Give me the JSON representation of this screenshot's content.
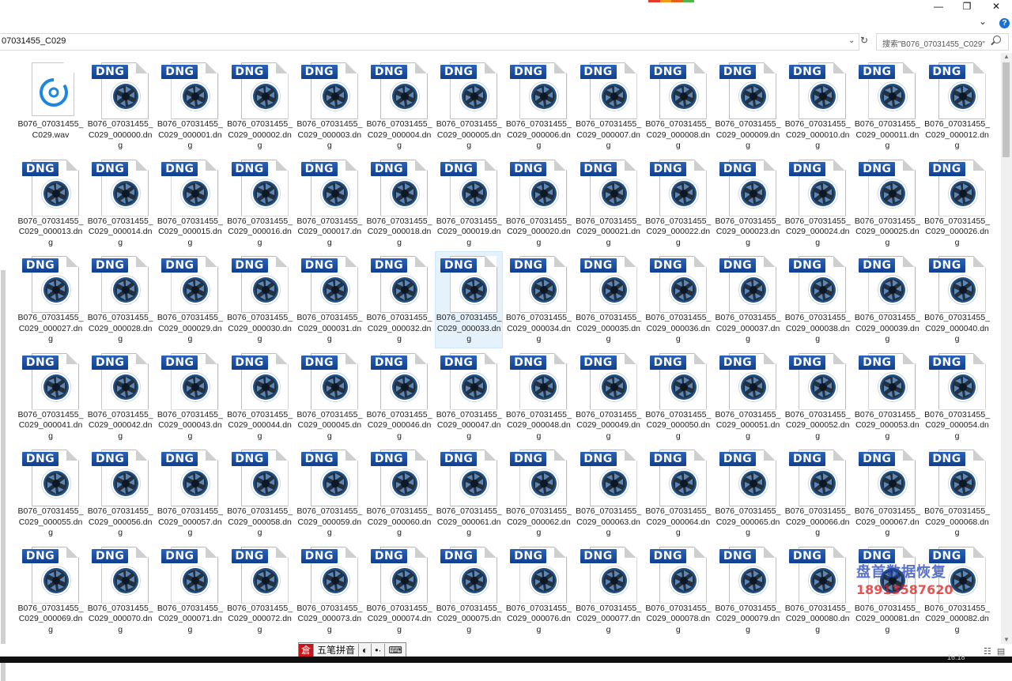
{
  "window": {
    "minimize_glyph": "—",
    "maximize_glyph": "❐",
    "close_glyph": "✕",
    "accent_strip": [
      "#e23a2b",
      "#f09b16",
      "#e95d1d",
      "#52b748"
    ]
  },
  "ribbon": {
    "expand_glyph": "⌄",
    "help_glyph": "?"
  },
  "address": {
    "path": "07031455_C029",
    "dropdown_glyph": "⌄",
    "refresh_glyph": "↻"
  },
  "search": {
    "placeholder": "搜索\"B076_07031455_C029\""
  },
  "files": {
    "wav": {
      "name": "B076_07031455_C029.wav",
      "icon": "audio-file-icon"
    },
    "dng_label": "DNG",
    "dng_icon": "dng-image-file-icon",
    "dng_names": [
      "B076_07031455_C029_000000.dng",
      "B076_07031455_C029_000001.dng",
      "B076_07031455_C029_000002.dng",
      "B076_07031455_C029_000003.dng",
      "B076_07031455_C029_000004.dng",
      "B076_07031455_C029_000005.dng",
      "B076_07031455_C029_000006.dng",
      "B076_07031455_C029_000007.dng",
      "B076_07031455_C029_000008.dng",
      "B076_07031455_C029_000009.dng",
      "B076_07031455_C029_000010.dng",
      "B076_07031455_C029_000011.dng",
      "B076_07031455_C029_000012.dng",
      "B076_07031455_C029_000013.dng",
      "B076_07031455_C029_000014.dng",
      "B076_07031455_C029_000015.dng",
      "B076_07031455_C029_000016.dng",
      "B076_07031455_C029_000017.dng",
      "B076_07031455_C029_000018.dng",
      "B076_07031455_C029_000019.dng",
      "B076_07031455_C029_000020.dng",
      "B076_07031455_C029_000021.dng",
      "B076_07031455_C029_000022.dng",
      "B076_07031455_C029_000023.dng",
      "B076_07031455_C029_000024.dng",
      "B076_07031455_C029_000025.dng",
      "B076_07031455_C029_000026.dng",
      "B076_07031455_C029_000027.dng",
      "B076_07031455_C029_000028.dng",
      "B076_07031455_C029_000029.dng",
      "B076_07031455_C029_000030.dng",
      "B076_07031455_C029_000031.dng",
      "B076_07031455_C029_000032.dng",
      "B076_07031455_C029_000033.dng",
      "B076_07031455_C029_000034.dng",
      "B076_07031455_C029_000035.dng",
      "B076_07031455_C029_000036.dng",
      "B076_07031455_C029_000037.dng",
      "B076_07031455_C029_000038.dng",
      "B076_07031455_C029_000039.dng",
      "B076_07031455_C029_000040.dng",
      "B076_07031455_C029_000041.dng",
      "B076_07031455_C029_000042.dng",
      "B076_07031455_C029_000043.dng",
      "B076_07031455_C029_000044.dng",
      "B076_07031455_C029_000045.dng",
      "B076_07031455_C029_000046.dng",
      "B076_07031455_C029_000047.dng",
      "B076_07031455_C029_000048.dng",
      "B076_07031455_C029_000049.dng",
      "B076_07031455_C029_000050.dng",
      "B076_07031455_C029_000051.dng",
      "B076_07031455_C029_000052.dng",
      "B076_07031455_C029_000053.dng",
      "B076_07031455_C029_000054.dng",
      "B076_07031455_C029_000055.dng",
      "B076_07031455_C029_000056.dng",
      "B076_07031455_C029_000057.dng",
      "B076_07031455_C029_000058.dng",
      "B076_07031455_C029_000059.dng",
      "B076_07031455_C029_000060.dng",
      "B076_07031455_C029_000061.dng",
      "B076_07031455_C029_000062.dng",
      "B076_07031455_C029_000063.dng",
      "B076_07031455_C029_000064.dng",
      "B076_07031455_C029_000065.dng",
      "B076_07031455_C029_000066.dng",
      "B076_07031455_C029_000067.dng",
      "B076_07031455_C029_000068.dng",
      "B076_07031455_C029_000069.dng",
      "B076_07031455_C029_000070.dng",
      "B076_07031455_C029_000071.dng",
      "B076_07031455_C029_000072.dng",
      "B076_07031455_C029_000073.dng",
      "B076_07031455_C029_000074.dng",
      "B076_07031455_C029_000075.dng",
      "B076_07031455_C029_000076.dng",
      "B076_07031455_C029_000077.dng",
      "B076_07031455_C029_000078.dng",
      "B076_07031455_C029_000079.dng",
      "B076_07031455_C029_000080.dng",
      "B076_07031455_C029_000081.dng",
      "B076_07031455_C029_000082.dng"
    ],
    "selected_name": "B076_07031455_C029_000033.dng"
  },
  "ime": {
    "logo": "倉",
    "mode": "五笔拼音",
    "moon_glyph": "◐",
    "punct_glyph": "•·",
    "keyboard_glyph": "⌨"
  },
  "watermark": {
    "line1": "盘首数据恢复",
    "line2": "18913587620"
  },
  "statusbar": {
    "view_icons": "☷ ▤"
  },
  "taskbar": {
    "clock": "16:18"
  },
  "colors": {
    "selection_bg": "#e5f1fb",
    "dng_blue": "#1a4fa3",
    "watermark_blue": "#2442b8",
    "watermark_red": "#e01a1a"
  }
}
